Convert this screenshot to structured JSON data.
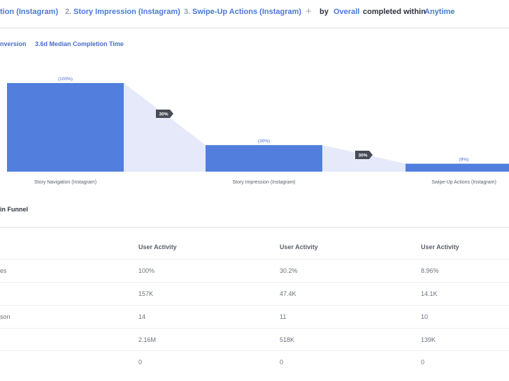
{
  "header": {
    "step1": "tion (Instagram)",
    "step2_num": "2.",
    "step2": "Story Impression (Instagram)",
    "step3_num": "3.",
    "step3": "Swipe-Up Actions (Instagram)",
    "add_icon": "plus-icon",
    "by_label": "by",
    "breakdown": "Overall",
    "completed_label": "completed within",
    "window": "Anytime"
  },
  "summary": {
    "conversion": "nversion",
    "median": "3.6d Median Completion Time"
  },
  "colors": {
    "bar": "#527fde",
    "funnel_fill": "#e5e9f9",
    "badge": "#474b55",
    "link": "#4a78d4"
  },
  "chart_data": {
    "type": "bar",
    "title": "",
    "categories": [
      "Story Navigation (Instagram)",
      "Story Impression (Instagram)",
      "Swipe-Up Actions (Instagram)"
    ],
    "values": [
      100,
      30,
      9
    ],
    "value_labels": [
      "(100%)",
      "(30%)",
      "(9%)"
    ],
    "step_conversions": [
      "30%",
      "30%"
    ],
    "xlabel": "",
    "ylabel": "",
    "ylim": [
      0,
      100
    ],
    "grid": false,
    "legend": "none"
  },
  "table": {
    "section_title": "in Funnel",
    "headers": [
      "",
      "User Activity",
      "User Activity",
      "User Activity"
    ],
    "rows": [
      [
        "es",
        "100%",
        "30.2%",
        "8.96%"
      ],
      [
        "",
        "157K",
        "47.4K",
        "14.1K"
      ],
      [
        "son",
        "14",
        "11",
        "10"
      ],
      [
        "",
        "2.16M",
        "518K",
        "139K"
      ],
      [
        "",
        "0",
        "0",
        "0"
      ]
    ]
  }
}
